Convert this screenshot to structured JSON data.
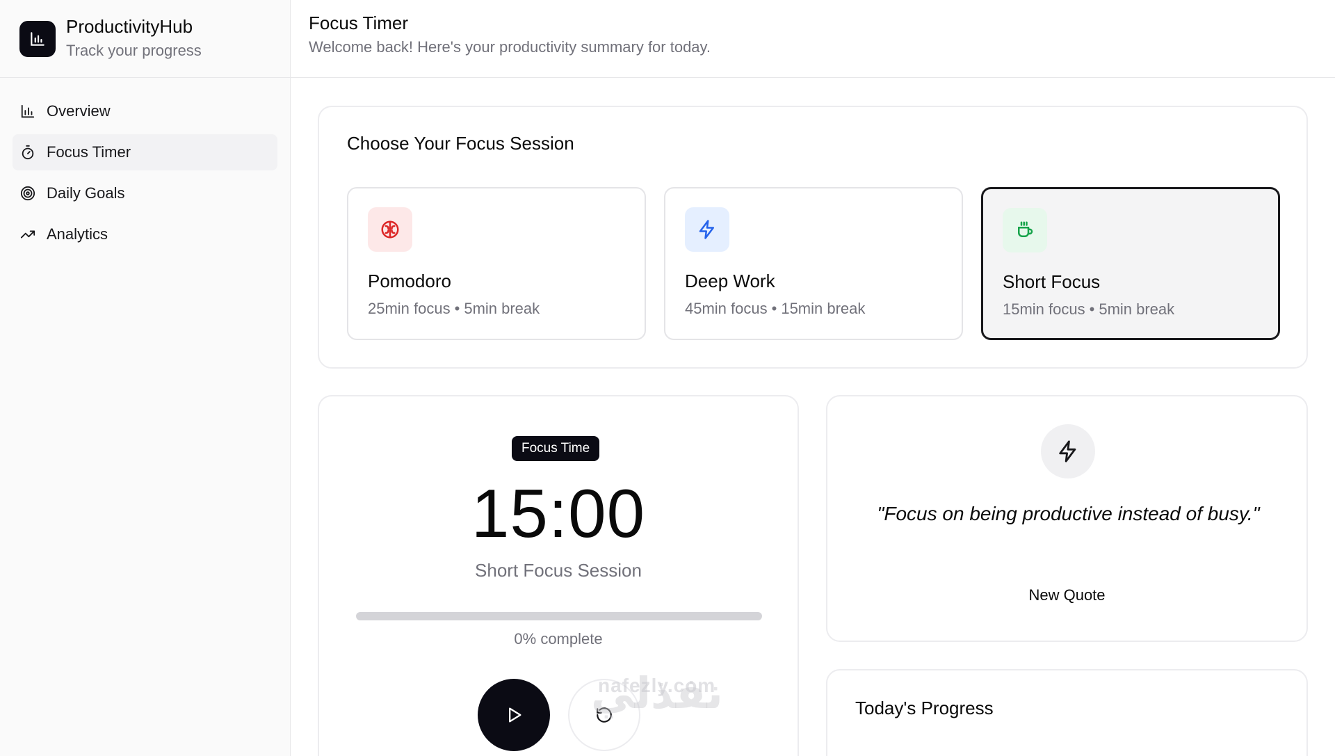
{
  "app": {
    "name": "ProductivityHub",
    "tagline": "Track your progress"
  },
  "sidebar": {
    "items": [
      {
        "label": "Overview",
        "icon": "bar-chart-icon",
        "active": false
      },
      {
        "label": "Focus Timer",
        "icon": "timer-icon",
        "active": true
      },
      {
        "label": "Daily Goals",
        "icon": "target-icon",
        "active": false
      },
      {
        "label": "Analytics",
        "icon": "trending-up-icon",
        "active": false
      }
    ]
  },
  "header": {
    "title": "Focus Timer",
    "subtitle": "Welcome back! Here's your productivity summary for today."
  },
  "choose": {
    "title": "Choose Your Focus Session",
    "sessions": [
      {
        "name": "Pomodoro",
        "focus": "25min focus",
        "break": "5min break",
        "icon": "brain-icon",
        "icon_bg": "#fde8e8",
        "icon_color": "#dc2626",
        "selected": false
      },
      {
        "name": "Deep Work",
        "focus": "45min focus",
        "break": "15min break",
        "icon": "zap-icon",
        "icon_bg": "#e5efff",
        "icon_color": "#2563eb",
        "selected": false
      },
      {
        "name": "Short Focus",
        "focus": "15min focus",
        "break": "5min break",
        "icon": "coffee-icon",
        "icon_bg": "#e7f8ec",
        "icon_color": "#16a34a",
        "selected": true
      }
    ],
    "separator": "•"
  },
  "timer": {
    "badge": "Focus Time",
    "time": "15:00",
    "session_label": "Short Focus Session",
    "progress_fraction": 0,
    "progress_text": "0% complete"
  },
  "quote": {
    "text": "\"Focus on being productive instead of busy.\"",
    "button": "New Quote"
  },
  "today": {
    "title": "Today's Progress"
  },
  "watermark": {
    "text": "nafezly.com",
    "arabic": "نفذلي"
  },
  "colors": {
    "primary": "#0b0b14",
    "muted": "#71717a",
    "border": "#e7e7e9"
  }
}
